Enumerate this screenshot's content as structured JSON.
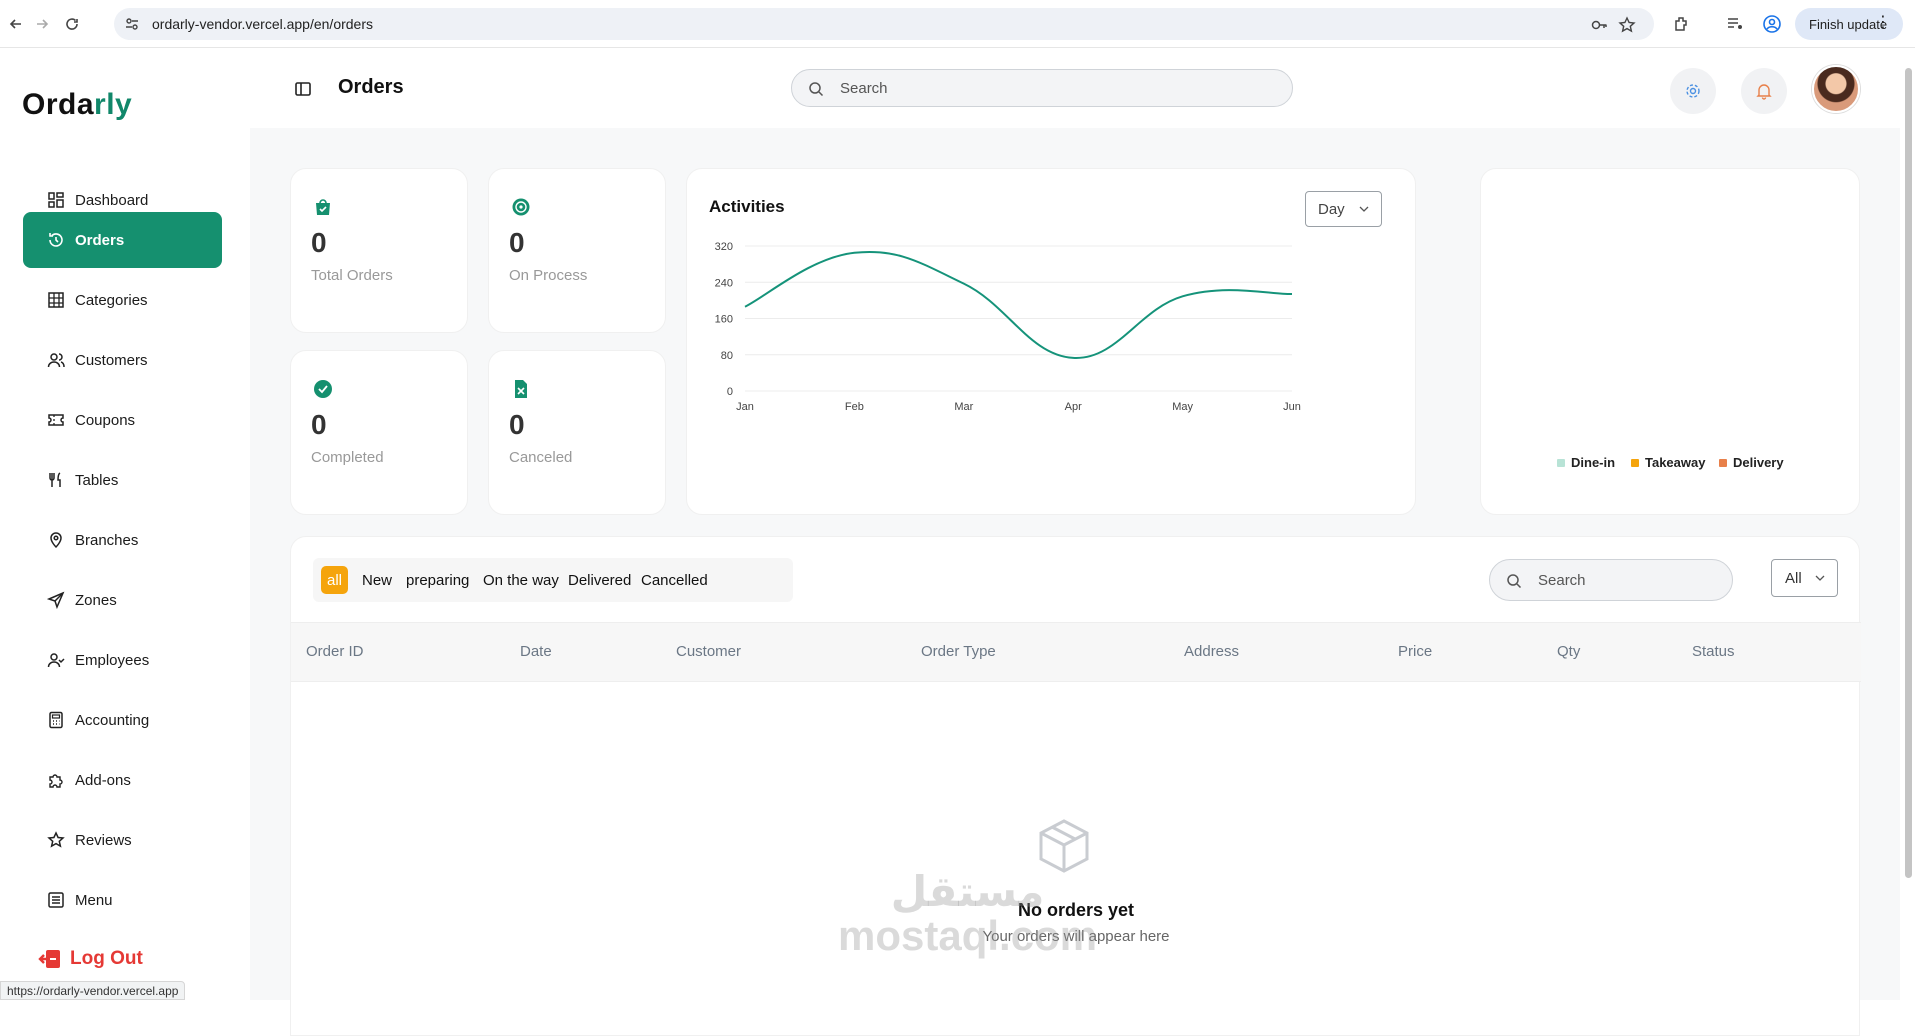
{
  "browser": {
    "url": "ordarly-vendor.vercel.app/en/orders",
    "finish_update": "Finish update",
    "status_url": "https://ordarly-vendor.vercel.app"
  },
  "sidebar": {
    "logo_part1": "Orda",
    "logo_part2": "rly",
    "items": [
      {
        "label": "Dashboard",
        "icon": "dashboard-icon"
      },
      {
        "label": "Orders",
        "icon": "history-icon",
        "active": true
      },
      {
        "label": "Categories",
        "icon": "grid-icon"
      },
      {
        "label": "Customers",
        "icon": "users-icon"
      },
      {
        "label": "Coupons",
        "icon": "ticket-icon"
      },
      {
        "label": "Tables",
        "icon": "utensils-icon"
      },
      {
        "label": "Branches",
        "icon": "map-pin-icon"
      },
      {
        "label": "Zones",
        "icon": "send-icon"
      },
      {
        "label": "Employees",
        "icon": "user-check-icon"
      },
      {
        "label": "Accounting",
        "icon": "calculator-icon"
      },
      {
        "label": "Add-ons",
        "icon": "puzzle-icon"
      },
      {
        "label": "Reviews",
        "icon": "star-icon"
      },
      {
        "label": "Menu",
        "icon": "menu-icon"
      }
    ],
    "logout": "Log Out"
  },
  "header": {
    "title": "Orders",
    "search_placeholder": "Search"
  },
  "stats": [
    {
      "value": "0",
      "label": "Total Orders",
      "icon": "bag-check-icon"
    },
    {
      "value": "0",
      "label": "On Process",
      "icon": "badge-process-icon"
    },
    {
      "value": "0",
      "label": "Completed",
      "icon": "check-circle-icon"
    },
    {
      "value": "0",
      "label": "Canceled",
      "icon": "file-x-icon"
    }
  ],
  "activities": {
    "title": "Activities",
    "period": "Day"
  },
  "chart_data": {
    "type": "line",
    "title": "Activities",
    "categories": [
      "Jan",
      "Feb",
      "Mar",
      "Apr",
      "May",
      "Jun"
    ],
    "values": [
      186,
      305,
      237,
      73,
      209,
      214
    ],
    "ylim": [
      0,
      320
    ],
    "yticks": [
      0,
      80,
      160,
      240,
      320
    ],
    "grid": true,
    "color": "#15937a"
  },
  "order_type_legend": [
    {
      "name": "Dine-in",
      "color": "#b8e3d6"
    },
    {
      "name": "Takeaway",
      "color": "#f5a40c"
    },
    {
      "name": "Delivery",
      "color": "#e8804a"
    }
  ],
  "orders": {
    "tabs": [
      "all",
      "New",
      "preparing",
      "On the way",
      "Delivered",
      "Cancelled"
    ],
    "active_tab": "all",
    "search_placeholder": "Search",
    "filter": "All",
    "columns": [
      "Order ID",
      "Date",
      "Customer",
      "Order Type",
      "Address",
      "Price",
      "Qty",
      "Status"
    ],
    "empty_title": "No orders yet",
    "empty_subtitle": "Your orders will appear here"
  },
  "watermark": {
    "line1": "مستقل",
    "line2": "mostaql.com"
  },
  "colors": {
    "brand": "#15906f",
    "accent": "#f5a40c",
    "danger": "#e53935"
  }
}
